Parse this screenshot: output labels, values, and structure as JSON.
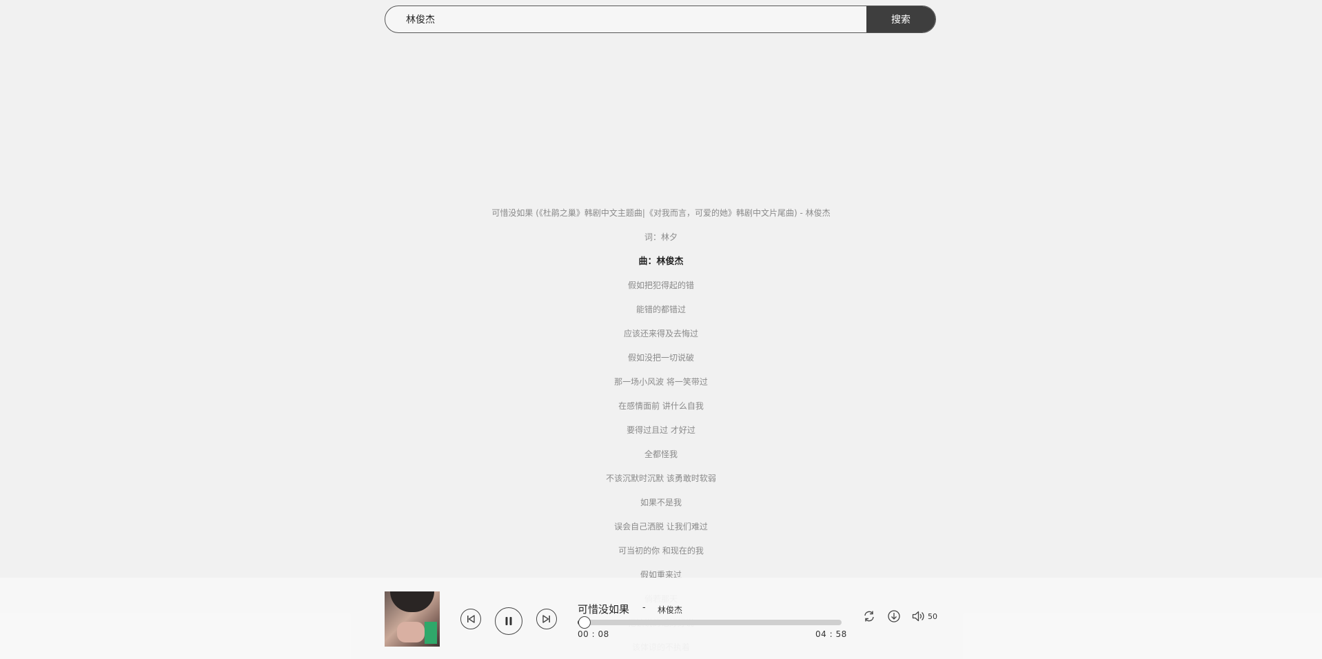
{
  "search": {
    "query": "林俊杰",
    "button_label": "搜索"
  },
  "lyrics": {
    "active_index": 2,
    "lines": [
      "可惜没如果 (《杜鹃之巢》韩剧中文主题曲|《对我而言，可爱的她》韩剧中文片尾曲) - 林俊杰",
      "词：林夕",
      "曲：林俊杰",
      "假如把犯得起的错",
      "能错的都错过",
      "应该还来得及去悔过",
      "假如没把一切说破",
      "那一场小风波 将一笑带过",
      "在感情面前 讲什么自我",
      "要得过且过 才好过",
      "全都怪我",
      "不该沉默时沉默 该勇敢时软弱",
      "如果不是我",
      "误会自己洒脱 让我们难过",
      "可当初的你 和现在的我",
      "假如重来过",
      "倘若那天",
      "把该说的话好好说",
      "该体谅的不执着"
    ]
  },
  "player": {
    "track_title": "可惜没如果",
    "separator": "-",
    "artist": "林俊杰",
    "current_time": "00 : 08",
    "total_time": "04 : 58",
    "progress_fraction": 0.027,
    "volume": "50",
    "icons": {
      "prev": "skip-previous-icon",
      "play_pause": "pause-icon",
      "next": "skip-next-icon",
      "loop": "loop-icon",
      "download": "download-icon",
      "volume": "volume-icon"
    }
  }
}
